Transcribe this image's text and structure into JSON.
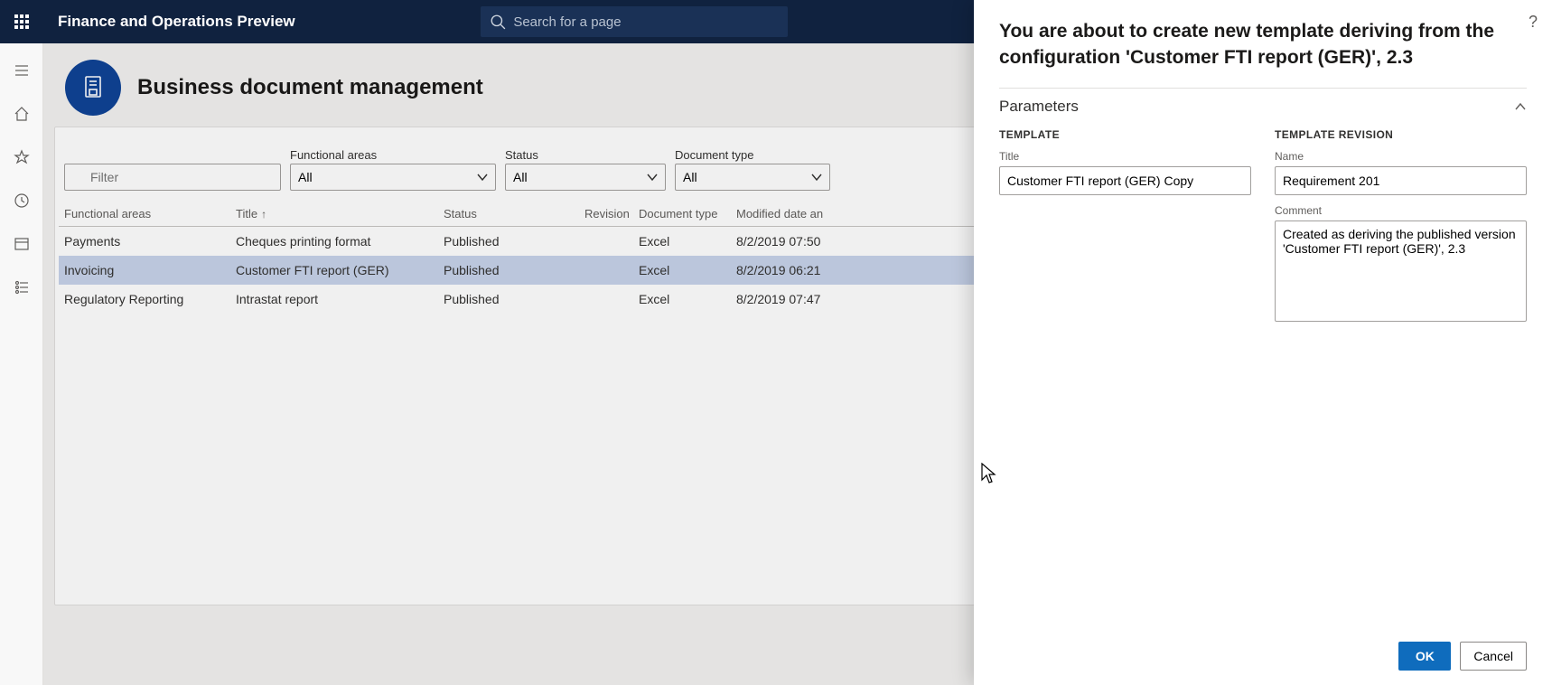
{
  "app": {
    "title": "Finance and Operations Preview"
  },
  "search": {
    "placeholder": "Search for a page"
  },
  "page": {
    "title": "Business document management"
  },
  "filters": {
    "filter_placeholder": "Filter",
    "functional_areas": {
      "label": "Functional areas",
      "value": "All"
    },
    "status": {
      "label": "Status",
      "value": "All"
    },
    "document_type": {
      "label": "Document type",
      "value": "All"
    }
  },
  "grid": {
    "columns": {
      "functional_areas": "Functional areas",
      "title": "Title",
      "status": "Status",
      "revision": "Revision",
      "document_type": "Document type",
      "modified": "Modified date an"
    },
    "rows": [
      {
        "functional_areas": "Payments",
        "title": "Cheques printing format",
        "status": "Published",
        "revision": "",
        "document_type": "Excel",
        "modified": "8/2/2019 07:50"
      },
      {
        "functional_areas": "Invoicing",
        "title": "Customer FTI report (GER)",
        "status": "Published",
        "revision": "",
        "document_type": "Excel",
        "modified": "8/2/2019 06:21"
      },
      {
        "functional_areas": "Regulatory Reporting",
        "title": "Intrastat report",
        "status": "Published",
        "revision": "",
        "document_type": "Excel",
        "modified": "8/2/2019 07:47"
      }
    ]
  },
  "flyout": {
    "heading": "You are about to create new template deriving from the configuration 'Customer FTI report (GER)', 2.3",
    "section": "Parameters",
    "template": {
      "section_label": "TEMPLATE",
      "title_label": "Title",
      "title_value": "Customer FTI report (GER) Copy"
    },
    "revision": {
      "section_label": "TEMPLATE REVISION",
      "name_label": "Name",
      "name_value": "Requirement 201",
      "comment_label": "Comment",
      "comment_value": "Created as deriving the published version 'Customer FTI report (GER)', 2.3"
    },
    "ok": "OK",
    "cancel": "Cancel"
  }
}
